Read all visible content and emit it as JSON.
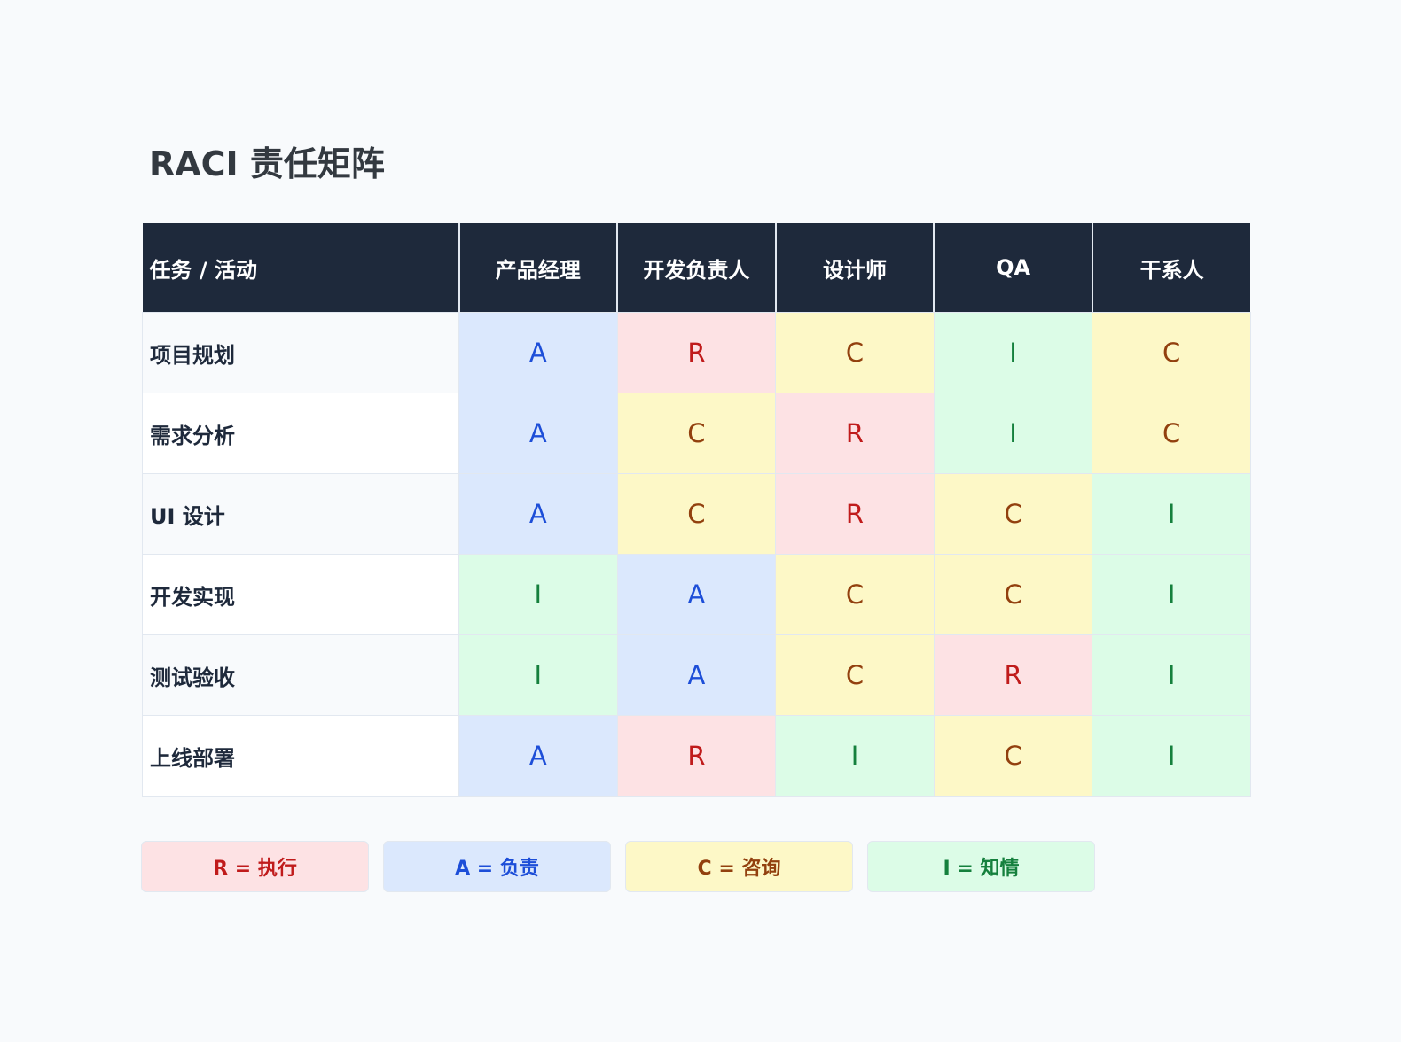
{
  "title": "RACI 责任矩阵",
  "table": {
    "header_task": "任务 / 活动",
    "roles": [
      "产品经理",
      "开发负责人",
      "设计师",
      "QA",
      "干系人"
    ],
    "rows": [
      {
        "task": "项目规划",
        "cells": [
          "A",
          "R",
          "C",
          "I",
          "C"
        ]
      },
      {
        "task": "需求分析",
        "cells": [
          "A",
          "C",
          "R",
          "I",
          "C"
        ]
      },
      {
        "task": "UI 设计",
        "cells": [
          "A",
          "C",
          "R",
          "C",
          "I"
        ]
      },
      {
        "task": "开发实现",
        "cells": [
          "I",
          "A",
          "C",
          "C",
          "I"
        ]
      },
      {
        "task": "测试验收",
        "cells": [
          "I",
          "A",
          "C",
          "R",
          "I"
        ]
      },
      {
        "task": "上线部署",
        "cells": [
          "A",
          "R",
          "I",
          "C",
          "I"
        ]
      }
    ]
  },
  "legend": [
    {
      "code": "R",
      "label": "R = 执行"
    },
    {
      "code": "A",
      "label": "A = 负责"
    },
    {
      "code": "C",
      "label": "C = 咨询"
    },
    {
      "code": "I",
      "label": "I = 知情"
    }
  ],
  "colors": {
    "R": {
      "bg": "#fde2e4",
      "fg": "#c01b1b"
    },
    "A": {
      "bg": "#dbe8fd",
      "fg": "#1d4ed8"
    },
    "C": {
      "bg": "#fdf8c7",
      "fg": "#92400e"
    },
    "I": {
      "bg": "#dcfce7",
      "fg": "#15803d"
    },
    "header_bg": "#1e293b",
    "page_bg": "#f8fafc"
  }
}
